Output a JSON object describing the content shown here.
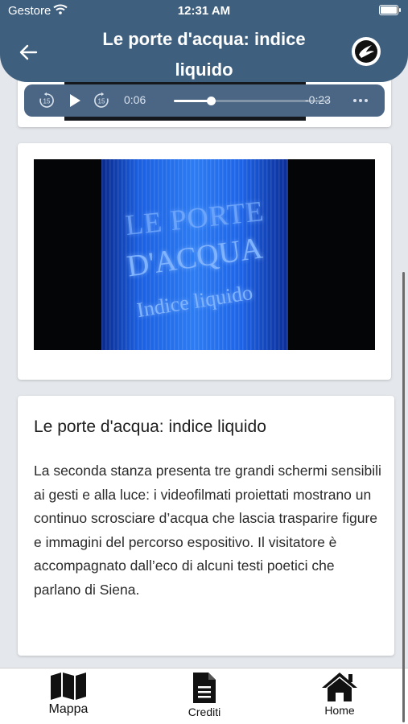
{
  "status_bar": {
    "carrier": "Gestore",
    "time": "12:31 AM"
  },
  "header": {
    "title": "Le porte d'acqua: indice liquido"
  },
  "audio_player": {
    "elapsed": "0:06",
    "remaining": "-0:23",
    "skip_seconds": "15",
    "progress_fraction": 0.24
  },
  "video": {
    "overlay_line1": "LE PORTE",
    "overlay_line2": "D'ACQUA",
    "overlay_line3": "Indice liquido"
  },
  "article": {
    "title": "Le porte d'acqua: indice liquido",
    "body": "La seconda stanza presenta tre grandi schermi sensibili ai gesti e alla luce: i videofilmati proiettati mostrano un continuo scrosciare d’acqua che lascia trasparire figure e immagini del percorso espositivo. Il visitatore è accompagnato dall’eco di alcuni testi poetici che parlano di Siena."
  },
  "tabs": [
    {
      "label": "Mappa",
      "icon": "map-icon"
    },
    {
      "label": "Crediti",
      "icon": "document-icon"
    },
    {
      "label": "Home",
      "icon": "home-icon"
    }
  ],
  "colors": {
    "header": "#3f5f7e",
    "player": "#4b6584",
    "video_water": "#2d7cf2"
  }
}
